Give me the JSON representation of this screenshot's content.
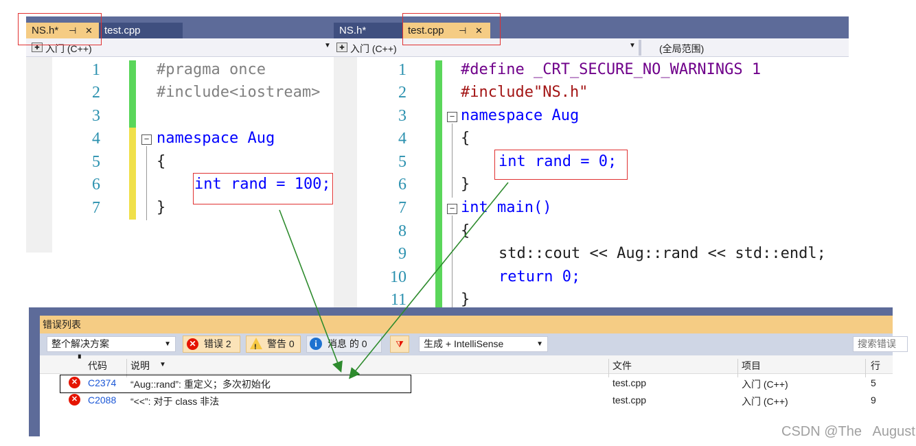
{
  "left_editor": {
    "tabs": [
      {
        "label": "NS.h*",
        "active": true
      },
      {
        "label": "test.cpp",
        "active": false
      }
    ],
    "nav_project": "入门 (C++)",
    "lines": [
      {
        "num": "1",
        "text": "#pragma once"
      },
      {
        "num": "2",
        "text": "#include<iostream>"
      },
      {
        "num": "3",
        "text": ""
      },
      {
        "num": "4",
        "text": "namespace Aug"
      },
      {
        "num": "5",
        "text": "{"
      },
      {
        "num": "6",
        "text": "int rand = 100;"
      },
      {
        "num": "7",
        "text": "}"
      }
    ]
  },
  "right_editor": {
    "tabs": [
      {
        "label": "NS.h*",
        "active": false
      },
      {
        "label": "test.cpp",
        "active": true
      }
    ],
    "nav_project": "入门 (C++)",
    "nav_scope": "(全局范围)",
    "lines": [
      {
        "num": "1",
        "text": "#define _CRT_SECURE_NO_WARNINGS 1"
      },
      {
        "num": "2",
        "text": "#include\"NS.h\""
      },
      {
        "num": "3",
        "text": "namespace Aug"
      },
      {
        "num": "4",
        "text": "{"
      },
      {
        "num": "5",
        "text": "int rand = 0;"
      },
      {
        "num": "6",
        "text": "}"
      },
      {
        "num": "7",
        "text": "int main()"
      },
      {
        "num": "8",
        "text": "{"
      },
      {
        "num": "9",
        "text": "std::cout << Aug::rand << std::endl;"
      },
      {
        "num": "10",
        "text": "return 0;"
      },
      {
        "num": "11",
        "text": "}"
      }
    ]
  },
  "error_list": {
    "title": "错误列表",
    "scope": "整个解决方案",
    "errors_btn": "错误 2",
    "warnings_btn": "警告 0",
    "messages_btn": "消息 的 0",
    "build_filter": "生成 + IntelliSense",
    "search_placeholder": "搜索错误",
    "columns": {
      "code": "代码",
      "desc": "说明",
      "file": "文件",
      "project": "项目",
      "line": "行"
    },
    "rows": [
      {
        "code": "C2374",
        "desc": "“Aug::rand”: 重定义；多次初始化",
        "file": "test.cpp",
        "project": "入门 (C++)",
        "line": "5"
      },
      {
        "code": "C2088",
        "desc": "“<<”: 对于 class 非法",
        "file": "test.cpp",
        "project": "入门 (C++)",
        "line": "9"
      }
    ]
  },
  "watermark": "CSDN @The   August",
  "colors": {
    "accent_tab": "#f5cc84",
    "chrome": "#5d6b99",
    "annotation_red": "#e03030",
    "arrow_green": "#2e8b2e"
  }
}
